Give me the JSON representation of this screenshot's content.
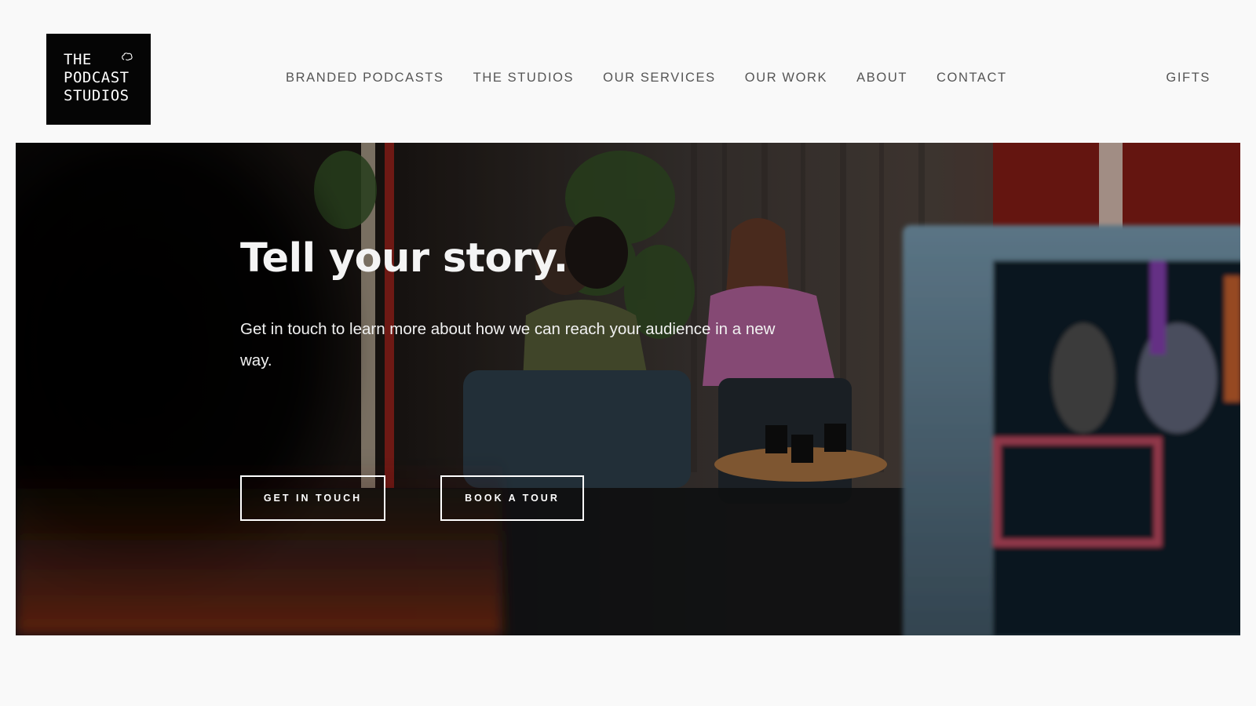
{
  "brand": {
    "logo_lines": [
      "THE",
      "PODCAST",
      "STUDIOS"
    ],
    "logo_icon": "brain-icon"
  },
  "nav": {
    "items": [
      {
        "label": "BRANDED PODCASTS"
      },
      {
        "label": "THE STUDIOS"
      },
      {
        "label": "OUR SERVICES"
      },
      {
        "label": "OUR WORK"
      },
      {
        "label": "ABOUT"
      },
      {
        "label": "CONTACT"
      }
    ],
    "gifts_label": "GIFTS"
  },
  "hero": {
    "title": "Tell your story.",
    "subtitle": "Get in touch to learn more about how we can reach your audience in a new way.",
    "buttons": {
      "get_in_touch": "GET IN TOUCH",
      "book_a_tour": "BOOK A TOUR"
    }
  },
  "colors": {
    "page_bg": "#f9f9f9",
    "nav_text": "#555555",
    "logo_bg": "#050505",
    "hero_text": "#ffffff"
  }
}
